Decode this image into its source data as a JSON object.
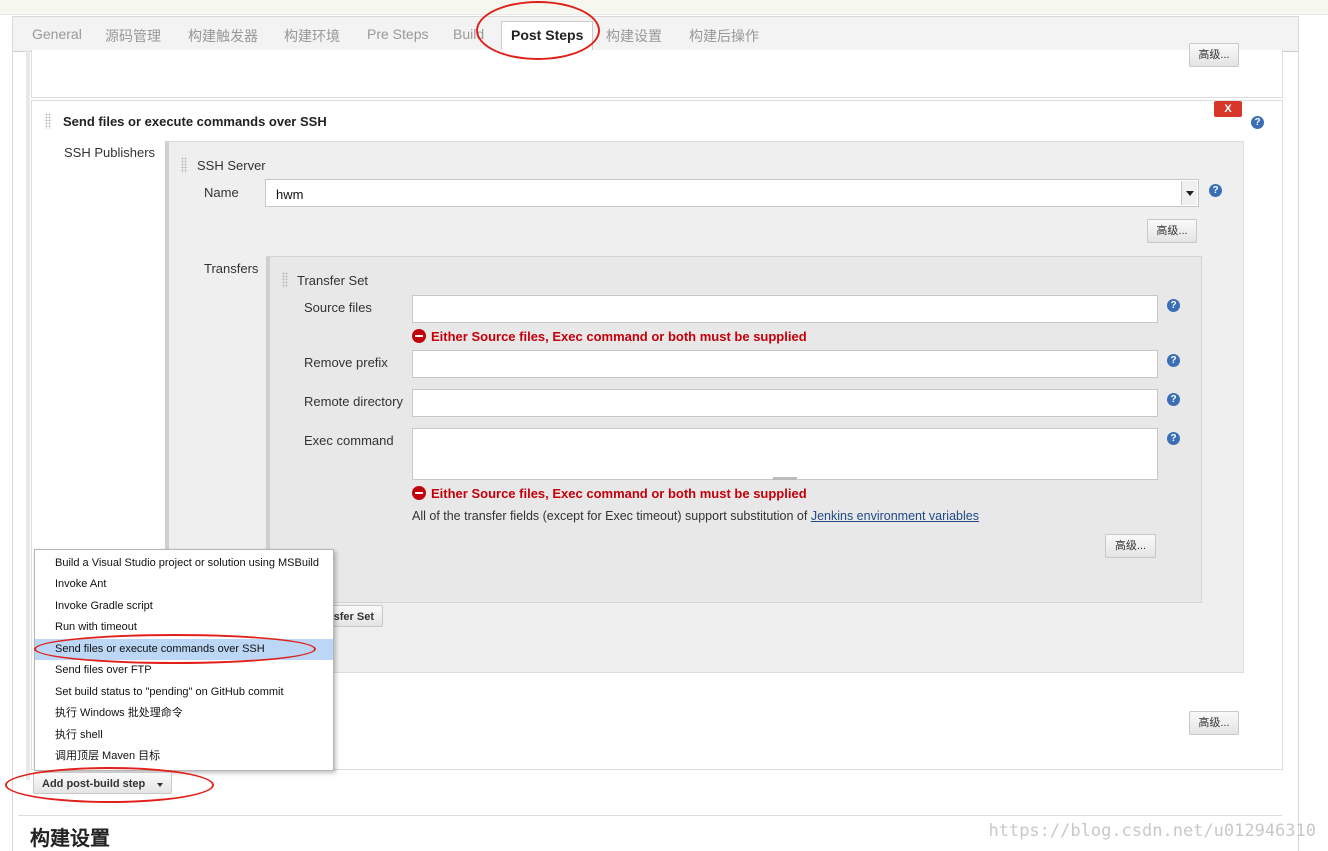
{
  "tabs": [
    {
      "label": "General",
      "active": false
    },
    {
      "label": "源码管理",
      "active": false
    },
    {
      "label": "构建触发器",
      "active": false
    },
    {
      "label": "构建环境",
      "active": false
    },
    {
      "label": "Pre Steps",
      "active": false
    },
    {
      "label": "Build",
      "active": false
    },
    {
      "label": "Post Steps",
      "active": true
    },
    {
      "label": "构建设置",
      "active": false
    },
    {
      "label": "构建后操作",
      "active": false
    }
  ],
  "advanced_label": "高级...",
  "ssh_step": {
    "title": "Send files or execute commands over SSH",
    "delete_label": "X",
    "publishers_label": "SSH Publishers",
    "server_label": "SSH Server",
    "name_label": "Name",
    "name_value": "hwm",
    "transfers_label": "Transfers",
    "transfer_set_label": "Transfer Set",
    "fields": {
      "source_files": "Source files",
      "remove_prefix": "Remove prefix",
      "remote_directory": "Remote directory",
      "exec_command": "Exec command"
    },
    "error_text": "Either Source files, Exec command or both must be supplied",
    "substitution_note": "All of the transfer fields (except for Exec timeout) support substitution of ",
    "env_link": "Jenkins environment variables",
    "add_transfer_set_partial": "sfer Set"
  },
  "dropdown_menu": {
    "items": [
      "Build a Visual Studio project or solution using MSBuild",
      "Invoke Ant",
      "Invoke Gradle script",
      "Run with timeout",
      "Send files or execute commands over SSH",
      "Send files over FTP",
      "Set build status to \"pending\" on GitHub commit",
      "执行 Windows 批处理命令",
      "执行 shell",
      "调用顶层 Maven 目标"
    ],
    "selected": "Send files or execute commands over SSH"
  },
  "add_post_build_step": "Add post-build step",
  "section_heading": "构建设置",
  "watermark": "https://blog.csdn.net/u012946310",
  "colors": {
    "error": "#c4000a",
    "highlight": "#bcd6f5",
    "annotation": "#e0201a",
    "link": "#204a87"
  }
}
